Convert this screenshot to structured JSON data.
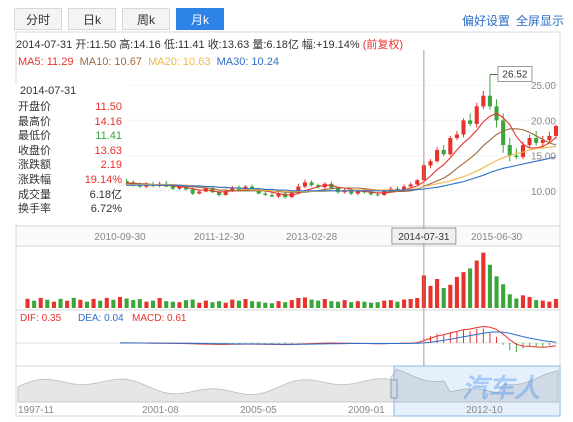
{
  "tabs": [
    {
      "label": "分时",
      "active": false
    },
    {
      "label": "日k",
      "active": false
    },
    {
      "label": "周k",
      "active": false
    },
    {
      "label": "月k",
      "active": true
    }
  ],
  "links": {
    "preferences": "偏好设置",
    "fullscreen": "全屏显示"
  },
  "header_line": {
    "date": "2014-07-31",
    "open_label": "开:",
    "open": "11.50",
    "high_label": "高:",
    "high": "14.16",
    "low_label": "低:",
    "low": "11.41",
    "close_label": "收:",
    "close": "13.63",
    "volume_label": "量:",
    "volume": "6.18亿",
    "change_label": "幅:",
    "change": "+19.14%",
    "adjust": "(前复权)"
  },
  "ma_line": {
    "ma5": "MA5: 11.29",
    "ma10": "MA10: 10.67",
    "ma20": "MA20: 10.63",
    "ma30": "MA30: 10.24"
  },
  "info_box": {
    "date": "2014-07-31",
    "rows": [
      {
        "label": "开盘价",
        "value": "11.50",
        "color": "#e8322c"
      },
      {
        "label": "最高价",
        "value": "14.16",
        "color": "#e8322c"
      },
      {
        "label": "最低价",
        "value": "11.41",
        "color": "#3aa63a"
      },
      {
        "label": "收盘价",
        "value": "13.63",
        "color": "#e8322c"
      },
      {
        "label": "涨跌额",
        "value": "2.19",
        "color": "#e8322c"
      },
      {
        "label": "涨跌幅",
        "value": "19.14%",
        "color": "#e8322c"
      },
      {
        "label": "成交量",
        "value": "6.18亿",
        "color": "#333333"
      },
      {
        "label": "换手率",
        "value": "6.72%",
        "color": "#333333"
      }
    ]
  },
  "price_axis": [
    "25.00",
    "20.00",
    "15.00",
    "10.00"
  ],
  "peak_label": "26.52",
  "date_axis": [
    "2010-09-30",
    "2011-12-30",
    "2013-02-28",
    "2014-07-31",
    "2015-06-30"
  ],
  "macd_line": {
    "dif": "DIF: 0.35",
    "dea": "DEA: 0.04",
    "macd": "MACD: 0.61"
  },
  "overview_axis": [
    "1997-11",
    "2001-08",
    "2005-05",
    "2009-01",
    "2012-10"
  ],
  "watermark": "汽车人",
  "colors": {
    "up": "#e8322c",
    "down": "#3aa63a",
    "ma5": "#e8322c",
    "ma10": "#a06a3c",
    "ma20": "#f0b84a",
    "ma30": "#2e6fc9",
    "accent": "#2e83e8"
  },
  "chart_data": {
    "type": "candlestick",
    "title": "",
    "x": [
      "2010-09",
      "2010-10",
      "2010-11",
      "2010-12",
      "2011-01",
      "2011-02",
      "2011-03",
      "2011-04",
      "2011-05",
      "2011-06",
      "2011-07",
      "2011-08",
      "2011-09",
      "2011-10",
      "2011-11",
      "2011-12",
      "2012-01",
      "2012-02",
      "2012-03",
      "2012-04",
      "2012-05",
      "2012-06",
      "2012-07",
      "2012-08",
      "2012-09",
      "2012-10",
      "2012-11",
      "2012-12",
      "2013-01",
      "2013-02",
      "2013-03",
      "2013-04",
      "2013-05",
      "2013-06",
      "2013-07",
      "2013-08",
      "2013-09",
      "2013-10",
      "2013-11",
      "2013-12",
      "2014-01",
      "2014-02",
      "2014-03",
      "2014-04",
      "2014-05",
      "2014-06",
      "2014-07",
      "2014-08",
      "2014-09",
      "2014-10",
      "2014-11",
      "2014-12",
      "2015-01",
      "2015-02",
      "2015-03",
      "2015-04",
      "2015-05",
      "2015-06",
      "2015-07",
      "2015-08",
      "2015-09",
      "2015-10",
      "2015-11",
      "2015-12",
      "2016-01",
      "2016-02",
      "2016-03"
    ],
    "open": [
      10.8,
      11.4,
      11.2,
      10.9,
      10.6,
      10.9,
      10.7,
      11.0,
      10.6,
      10.3,
      10.6,
      10.2,
      9.6,
      9.9,
      10.4,
      9.8,
      9.4,
      9.9,
      10.5,
      10.0,
      10.6,
      10.2,
      9.6,
      9.4,
      9.2,
      9.6,
      9.1,
      9.7,
      10.6,
      11.2,
      10.8,
      10.5,
      11.0,
      10.4,
      9.8,
      10.1,
      9.6,
      10.0,
      9.8,
      9.5,
      9.4,
      10.0,
      10.3,
      10.1,
      10.6,
      10.9,
      11.5,
      13.6,
      14.2,
      15.8,
      15.2,
      17.5,
      18.0,
      20.0,
      19.5,
      22.0,
      23.5,
      22.0,
      20.0,
      16.5,
      15.0,
      14.8,
      16.5,
      17.5,
      16.8,
      17.2,
      17.8
    ],
    "high": [
      11.8,
      11.7,
      11.5,
      11.2,
      11.2,
      11.3,
      11.3,
      11.4,
      10.9,
      10.8,
      10.9,
      10.5,
      10.1,
      10.7,
      10.7,
      10.0,
      10.1,
      10.7,
      10.8,
      10.8,
      10.9,
      10.4,
      9.9,
      9.7,
      9.8,
      9.8,
      9.9,
      11.0,
      11.6,
      11.5,
      11.0,
      11.2,
      11.3,
      10.6,
      10.4,
      10.3,
      10.2,
      10.3,
      10.0,
      9.8,
      10.2,
      10.6,
      10.6,
      10.9,
      11.2,
      11.7,
      14.16,
      14.5,
      16.2,
      16.5,
      17.8,
      18.5,
      20.3,
      21.0,
      22.5,
      24.2,
      26.52,
      23.0,
      21.0,
      17.5,
      16.0,
      17.0,
      18.0,
      18.5,
      17.8,
      18.4,
      19.4
    ],
    "low": [
      10.6,
      10.9,
      10.6,
      10.4,
      10.4,
      10.5,
      10.5,
      10.5,
      10.1,
      10.1,
      10.0,
      9.4,
      9.5,
      9.8,
      9.7,
      9.2,
      9.3,
      9.8,
      9.9,
      9.9,
      10.1,
      9.5,
      9.3,
      9.1,
      9.0,
      8.9,
      9.0,
      9.6,
      10.4,
      10.6,
      10.3,
      10.3,
      10.2,
      9.6,
      9.6,
      9.4,
      9.4,
      9.6,
      9.3,
      9.2,
      9.3,
      9.9,
      10.0,
      10.0,
      10.5,
      10.8,
      11.41,
      13.2,
      14.0,
      14.9,
      15.0,
      17.2,
      17.6,
      19.2,
      19.0,
      21.6,
      21.5,
      19.0,
      15.4,
      14.2,
      14.5,
      14.5,
      16.2,
      16.4,
      16.2,
      16.8,
      17.4
    ],
    "close": [
      11.4,
      11.2,
      10.9,
      10.6,
      10.9,
      10.7,
      11.0,
      10.6,
      10.3,
      10.6,
      10.2,
      9.6,
      9.9,
      10.4,
      9.8,
      9.4,
      9.9,
      10.5,
      10.0,
      10.6,
      10.2,
      9.6,
      9.4,
      9.2,
      9.6,
      9.1,
      9.7,
      10.6,
      11.2,
      10.8,
      10.5,
      11.0,
      10.4,
      9.8,
      10.1,
      9.6,
      10.0,
      9.8,
      9.5,
      9.4,
      10.0,
      10.3,
      10.1,
      10.6,
      10.9,
      11.5,
      13.63,
      14.2,
      15.8,
      15.2,
      17.5,
      18.0,
      20.0,
      19.5,
      22.0,
      23.5,
      22.0,
      20.0,
      16.5,
      15.0,
      14.8,
      16.5,
      17.5,
      16.8,
      17.2,
      17.8,
      19.2
    ],
    "volume": [
      2.1,
      1.8,
      1.5,
      1.7,
      1.2,
      1.4,
      1.9,
      1.3,
      1.2,
      1.1,
      1.5,
      1.6,
      1.0,
      1.4,
      1.1,
      1.3,
      1.0,
      1.6,
      1.4,
      1.7,
      1.3,
      1.2,
      1.0,
      0.9,
      1.3,
      1.1,
      1.5,
      1.9,
      2.0,
      1.6,
      1.4,
      1.7,
      1.3,
      1.2,
      1.5,
      1.1,
      1.3,
      1.2,
      1.0,
      1.1,
      1.4,
      1.5,
      1.2,
      1.6,
      1.7,
      1.9,
      6.18,
      4.2,
      5.5,
      3.8,
      4.4,
      5.9,
      6.8,
      7.5,
      9.0,
      10.5,
      8.2,
      6.0,
      4.5,
      2.6,
      1.8,
      2.4,
      2.1,
      1.5,
      1.4,
      1.2,
      1.7
    ],
    "ma5": [
      11.0,
      11.1,
      11.1,
      11.0,
      10.9,
      10.9,
      10.8,
      10.8,
      10.7,
      10.6,
      10.5,
      10.3,
      10.1,
      10.1,
      10.0,
      9.8,
      9.9,
      10.0,
      10.0,
      10.1,
      10.2,
      10.2,
      10.0,
      9.8,
      9.6,
      9.4,
      9.4,
      9.6,
      10.0,
      10.3,
      10.6,
      10.8,
      10.8,
      10.5,
      10.4,
      10.2,
      10.0,
      9.9,
      9.8,
      9.7,
      9.7,
      9.8,
      9.9,
      10.1,
      10.4,
      10.7,
      11.29,
      12.1,
      13.0,
      13.7,
      14.7,
      15.8,
      16.8,
      17.6,
      18.6,
      19.8,
      20.6,
      21.0,
      20.4,
      19.4,
      17.7,
      16.6,
      16.1,
      16.1,
      16.3,
      16.8,
      17.6
    ],
    "ma10": [
      11.0,
      11.0,
      11.0,
      11.0,
      11.0,
      10.9,
      10.9,
      10.9,
      10.8,
      10.8,
      10.7,
      10.6,
      10.5,
      10.4,
      10.3,
      10.1,
      10.1,
      10.0,
      10.0,
      10.0,
      10.0,
      10.0,
      10.0,
      10.0,
      9.9,
      9.8,
      9.8,
      9.8,
      9.8,
      9.9,
      10.0,
      10.2,
      10.3,
      10.4,
      10.4,
      10.4,
      10.4,
      10.3,
      10.2,
      10.1,
      10.0,
      9.9,
      9.9,
      9.9,
      10.0,
      10.2,
      10.67,
      11.0,
      11.4,
      11.8,
      12.4,
      13.2,
      13.9,
      14.6,
      15.4,
      16.4,
      17.2,
      18.0,
      18.5,
      18.8,
      18.8,
      18.7,
      18.3,
      17.8,
      17.3,
      16.8,
      16.5
    ],
    "ma20": [
      10.9,
      10.9,
      10.9,
      10.9,
      10.9,
      10.9,
      10.9,
      10.9,
      10.9,
      10.8,
      10.8,
      10.7,
      10.7,
      10.6,
      10.6,
      10.5,
      10.4,
      10.4,
      10.3,
      10.2,
      10.2,
      10.1,
      10.1,
      10.0,
      10.0,
      9.9,
      9.9,
      9.9,
      9.9,
      9.9,
      9.9,
      9.9,
      10.0,
      10.0,
      10.0,
      10.1,
      10.1,
      10.1,
      10.1,
      10.1,
      10.1,
      10.1,
      10.1,
      10.1,
      10.2,
      10.3,
      10.63,
      10.8,
      11.0,
      11.2,
      11.4,
      11.7,
      12.0,
      12.4,
      12.8,
      13.3,
      13.8,
      14.3,
      14.7,
      15.0,
      15.3,
      15.5,
      15.8,
      16.0,
      16.1,
      16.2,
      16.3
    ],
    "ma30": [
      10.8,
      10.8,
      10.8,
      10.8,
      10.8,
      10.8,
      10.8,
      10.8,
      10.8,
      10.8,
      10.7,
      10.7,
      10.7,
      10.6,
      10.6,
      10.5,
      10.5,
      10.4,
      10.4,
      10.3,
      10.3,
      10.3,
      10.2,
      10.2,
      10.1,
      10.1,
      10.0,
      10.0,
      10.0,
      10.0,
      10.0,
      10.0,
      10.0,
      10.0,
      10.0,
      10.0,
      10.0,
      10.0,
      10.0,
      10.0,
      10.0,
      10.0,
      10.1,
      10.1,
      10.1,
      10.2,
      10.24,
      10.4,
      10.5,
      10.7,
      10.9,
      11.1,
      11.3,
      11.6,
      11.9,
      12.2,
      12.6,
      12.9,
      13.2,
      13.4,
      13.6,
      13.8,
      14.0,
      14.2,
      14.4,
      14.6,
      14.8
    ],
    "macd": [
      0.02,
      0.01,
      0.0,
      -0.02,
      -0.03,
      -0.03,
      -0.02,
      -0.04,
      -0.06,
      -0.05,
      -0.07,
      -0.11,
      -0.12,
      -0.1,
      -0.12,
      -0.15,
      -0.13,
      -0.09,
      -0.1,
      -0.07,
      -0.08,
      -0.11,
      -0.13,
      -0.15,
      -0.13,
      -0.15,
      -0.12,
      -0.06,
      0.0,
      0.02,
      0.01,
      0.04,
      0.01,
      -0.03,
      -0.02,
      -0.05,
      -0.04,
      -0.05,
      -0.07,
      -0.08,
      -0.05,
      -0.02,
      -0.03,
      0.01,
      0.04,
      0.1,
      0.61,
      0.8,
      1.05,
      0.95,
      1.2,
      1.25,
      1.45,
      1.3,
      1.55,
      1.6,
      1.2,
      0.7,
      -0.2,
      -0.8,
      -1.0,
      -0.6,
      -0.3,
      -0.45,
      -0.4,
      -0.25,
      -0.05
    ],
    "overview_axis_dates": [
      "1997-11",
      "2001-08",
      "2005-05",
      "2009-01",
      "2012-10"
    ]
  }
}
